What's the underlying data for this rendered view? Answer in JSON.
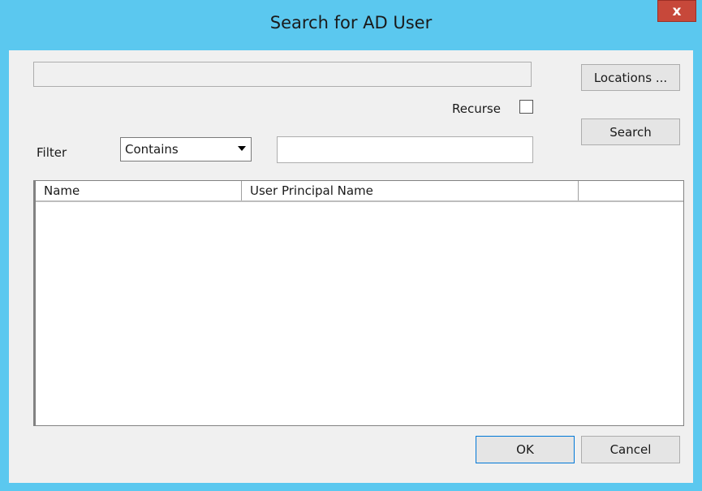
{
  "window": {
    "title": "Search for AD User",
    "close_label": "x"
  },
  "locations": {
    "button_label": "Locations ...",
    "field_value": ""
  },
  "recurse": {
    "label": "Recurse",
    "checked": false
  },
  "search": {
    "button_label": "Search"
  },
  "filter": {
    "label": "Filter",
    "selected_option": "Contains",
    "text_value": ""
  },
  "results": {
    "columns": [
      "Name",
      "User Principal Name",
      ""
    ],
    "rows": []
  },
  "footer": {
    "ok_label": "OK",
    "cancel_label": "Cancel"
  },
  "colors": {
    "titlebar": "#5bc8ef",
    "close_button": "#c7483a",
    "client_bg": "#f0f0f0"
  }
}
